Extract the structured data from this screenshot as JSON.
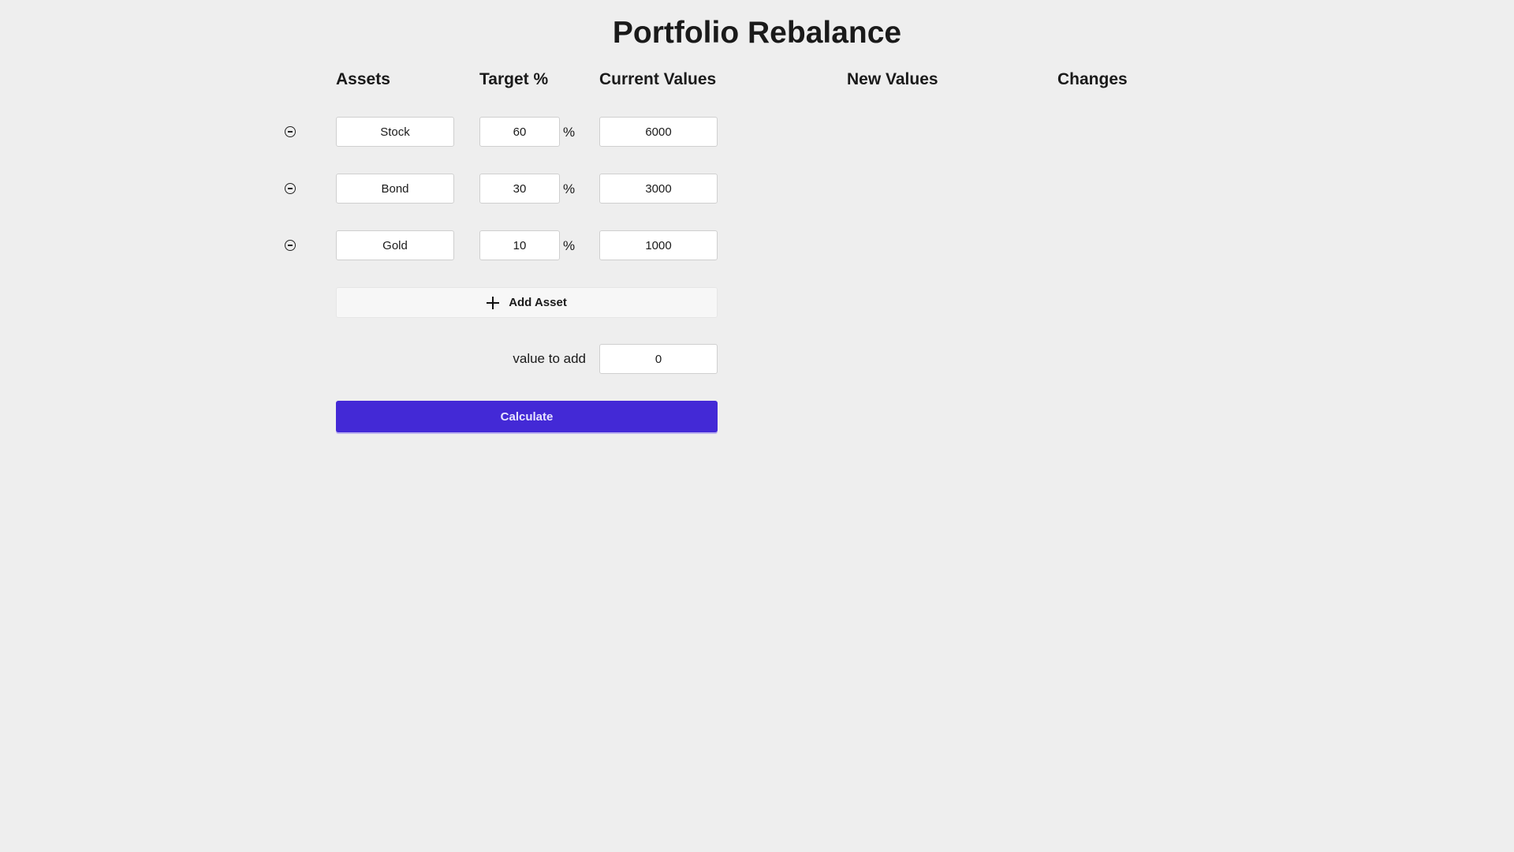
{
  "title": "Portfolio Rebalance",
  "headers": {
    "assets": "Assets",
    "target": "Target %",
    "current": "Current Values",
    "new_values": "New Values",
    "changes": "Changes"
  },
  "rows": [
    {
      "asset": "Stock",
      "target": "60",
      "current": "6000"
    },
    {
      "asset": "Bond",
      "target": "30",
      "current": "3000"
    },
    {
      "asset": "Gold",
      "target": "10",
      "current": "1000"
    }
  ],
  "percent_symbol": "%",
  "add_asset_label": "Add Asset",
  "value_to_add": {
    "label": "value to add",
    "value": "0"
  },
  "calculate_label": "Calculate",
  "colors": {
    "accent": "#4329d6",
    "background": "#eeeeee"
  }
}
